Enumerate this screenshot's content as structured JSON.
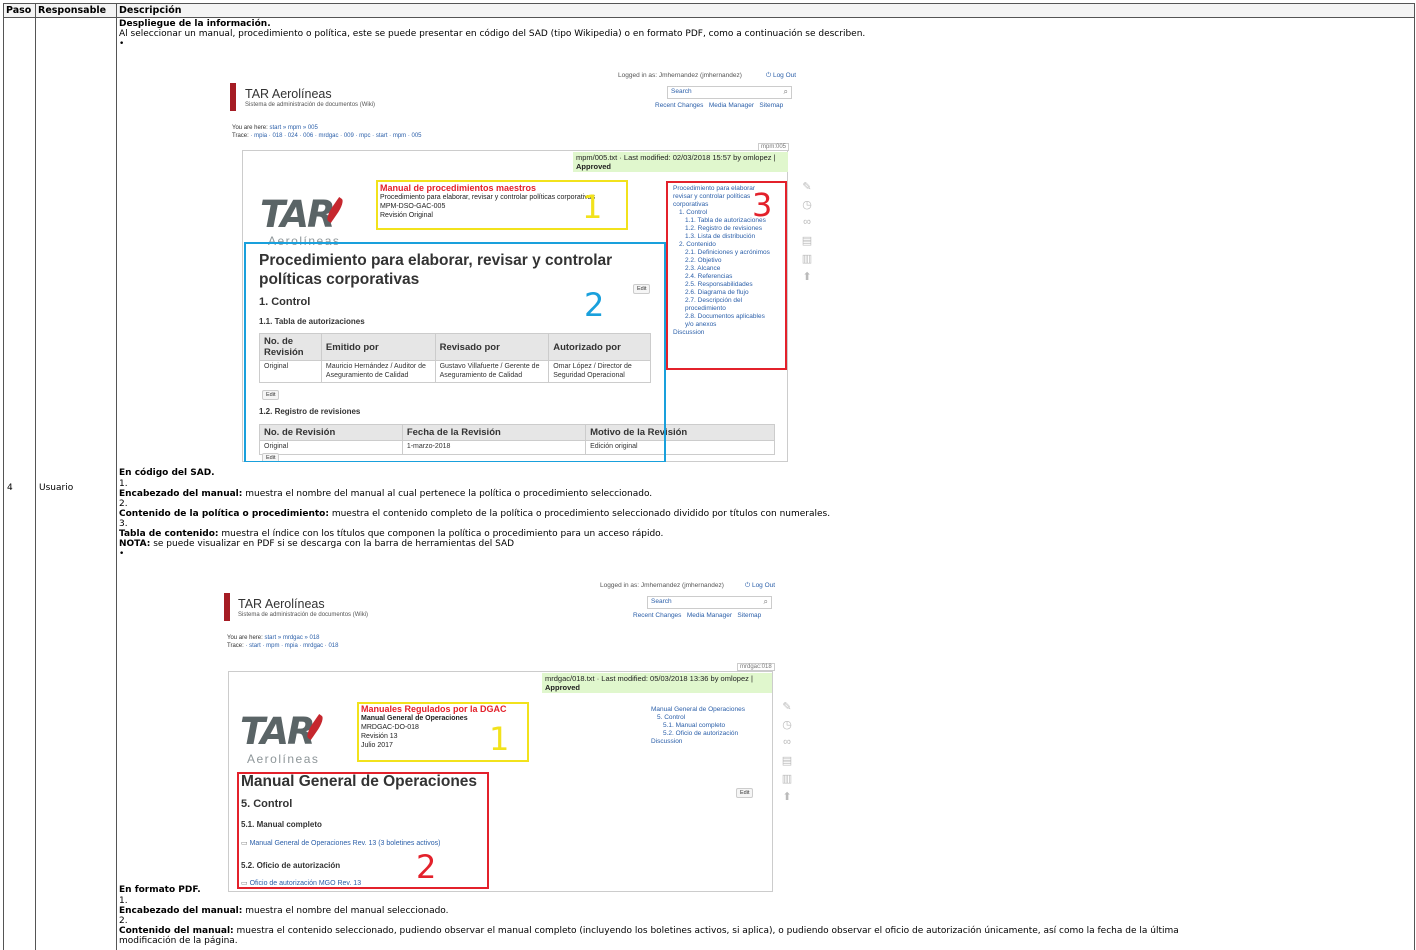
{
  "table": {
    "headers": [
      "Paso",
      "Responsable",
      "Descripción"
    ],
    "step": "4",
    "responsible": "Usuario"
  },
  "desc": {
    "heading": "Despliegue de la información.",
    "intro": "Al seleccionar un manual, procedimiento o política, este se puede presentar en código del SAD (tipo Wikipedia) o en formato PDF, como a continuación se describen.",
    "bullet": "•",
    "sad_title": "En código del SAD.",
    "n1": "1.",
    "i1_b": "Encabezado del manual:",
    "i1_t": " muestra el nombre del manual al cual pertenece la política o procedimiento seleccionado.",
    "n2": "2.",
    "i2_b": "Contenido de la política o procedimiento:",
    "i2_t": " muestra el contenido completo de la política o procedimiento seleccionado dividido por títulos con numerales.",
    "n3": "3.",
    "i3_b": "Tabla de contenido:",
    "i3_t": " muestra el índice con los títulos que componen la política o procedimiento para un acceso rápido.",
    "note_b": "NOTA:",
    "note_t": " se puede visualizar en PDF si se descarga con la barra de herramientas del SAD",
    "pdf_title": "En formato PDF.",
    "p1": "1.",
    "p1_b": "Encabezado del manual:",
    "p1_t": " muestra el nombre del manual seleccionado.",
    "p2": "2.",
    "p2_b": "Contenido del manual:",
    "p2_t1": " muestra el contenido seleccionado, pudiendo observar el manual completo (incluyendo los boletines activos, si aplica), o pudiendo observar el oficio de autorización únicamente, así como la fecha de la última",
    "p2_t2": "modificación de la página."
  },
  "wiki": {
    "site_title": "TAR Aerolíneas",
    "site_sub": "Sistema de administración de documentos (Wiki)",
    "logged_in": "Logged in as: Jmhernandez (jmhernandez)",
    "logout": "Log Out",
    "search_placeholder": "Search",
    "nav": "Recent Changes   Media Manager   Sitemap",
    "logo_tar": "TAR",
    "logo_aero": "Aerolíneas",
    "edit": "Edit"
  },
  "shot1": {
    "here_label": "You are here:",
    "here_path": "start » mpm » 005",
    "trace_label": "Trace:",
    "trace_path": "· mpia · 018 · 024 · 006 · mrdgac · 009 · mpc · start · mpm · 005",
    "pageid": "mpm:005",
    "modified": "mpm/005.txt · Last modified: 02/03/2018 15:57 by omlopez |",
    "approved": "Approved",
    "hdr_red": "Manual de procedimientos maestros",
    "hdr_l1": "Procedimiento para elaborar, revisar y controlar políticas corporativas",
    "hdr_l2": "MPM-DSO-GAC-005",
    "hdr_l3": "Revisión Original",
    "num1": "1",
    "num2": "2",
    "num3": "3",
    "h1a": "Procedimiento para elaborar, revisar y controlar",
    "h1b": "políticas corporativas",
    "h2": "1. Control",
    "h3a": "1.1. Tabla de autorizaciones",
    "t1_headers": [
      "No. de Revisión",
      "Emitido por",
      "Revisado por",
      "Autorizado por"
    ],
    "t1_row": [
      "Original",
      "Mauricio Hernández / Auditor de Aseguramiento de Calidad",
      "Gustavo Villafuerte / Gerente de Aseguramiento de Calidad",
      "Omar López / Director de Seguridad Operacional"
    ],
    "h3b": "1.2. Registro de revisiones",
    "t2_headers": [
      "No. de Revisión",
      "Fecha de la Revisión",
      "Motivo de la Revisión"
    ],
    "t2_row": [
      "Original",
      "1-marzo-2018",
      "Edición original"
    ],
    "toc": [
      "Procedimiento para elaborar revisar y controlar políticas corporativas",
      "1. Control",
      "1.1. Tabla de autorizaciones",
      "1.2. Registro de revisiones",
      "1.3. Lista de distribución",
      "2. Contenido",
      "2.1. Definiciones y acrónimos",
      "2.2. Objetivo",
      "2.3. Alcance",
      "2.4. Referencias",
      "2.5. Responsabilidades",
      "2.6. Diagrama de flujo",
      "2.7. Descripción del procedimiento",
      "2.8. Documentos aplicables y/o anexos",
      "Discussion"
    ]
  },
  "shot2": {
    "here_label": "You are here:",
    "here_path": "start » mrdgac » 018",
    "trace_label": "Trace:",
    "trace_path": "· start · mpm · mpia · mrdgac · 018",
    "pageid": "mrdgac:018",
    "modified": "mrdgac/018.txt · Last modified: 05/03/2018 13:36 by omlopez |",
    "approved": "Approved",
    "hdr_red": "Manuales Regulados por la DGAC",
    "hdr_l1": "Manual General de Operaciones",
    "hdr_l2": "MRDGAC-DO-018",
    "hdr_l3": "Revisión 13",
    "hdr_l4": "Julio 2017",
    "num1": "1",
    "num2": "2",
    "h1": "Manual General de Operaciones",
    "h2": "5. Control",
    "h3a": "5.1. Manual completo",
    "link1": "Manual General de Operaciones Rev. 13 (3 boletines activos)",
    "h3b": "5.2. Oficio de autorización",
    "link2": "Oficio de autorización MGO Rev. 13",
    "toc": [
      "Manual General de Operaciones",
      "5. Control",
      "5.1. Manual completo",
      "5.2. Oficio de autorización",
      "Discussion"
    ]
  },
  "colors": {
    "yellow": "#f2e21c",
    "blue": "#19a0dc",
    "red": "#e3212b",
    "approved_bg": "#e0f7cd",
    "brand": "#a51c24"
  }
}
